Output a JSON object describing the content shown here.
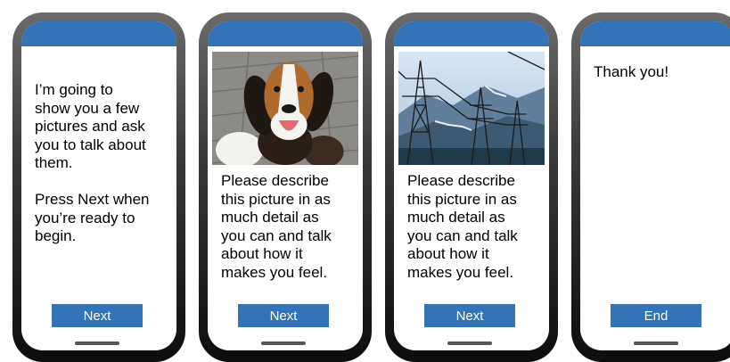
{
  "screens": [
    {
      "text": "I’m going to\nshow you a few\npictures and ask\nyou to talk about\nthem.\n\nPress Next when\nyou’re ready to\nbegin.",
      "button": "Next"
    },
    {
      "image": "beagle-puppy-photo",
      "text": "Please describe\nthis picture in as\nmuch detail as\nyou can and talk\nabout how it\nmakes you feel.",
      "button": "Next"
    },
    {
      "image": "power-pylons-photo",
      "text": "Please describe\nthis picture in as\nmuch detail as\nyou can and talk\nabout how it\nmakes you feel.",
      "button": "Next"
    },
    {
      "text": "Thank you!",
      "button": "End"
    }
  ],
  "colors": {
    "accent": "#3274b7",
    "button_text": "#ffffff"
  }
}
